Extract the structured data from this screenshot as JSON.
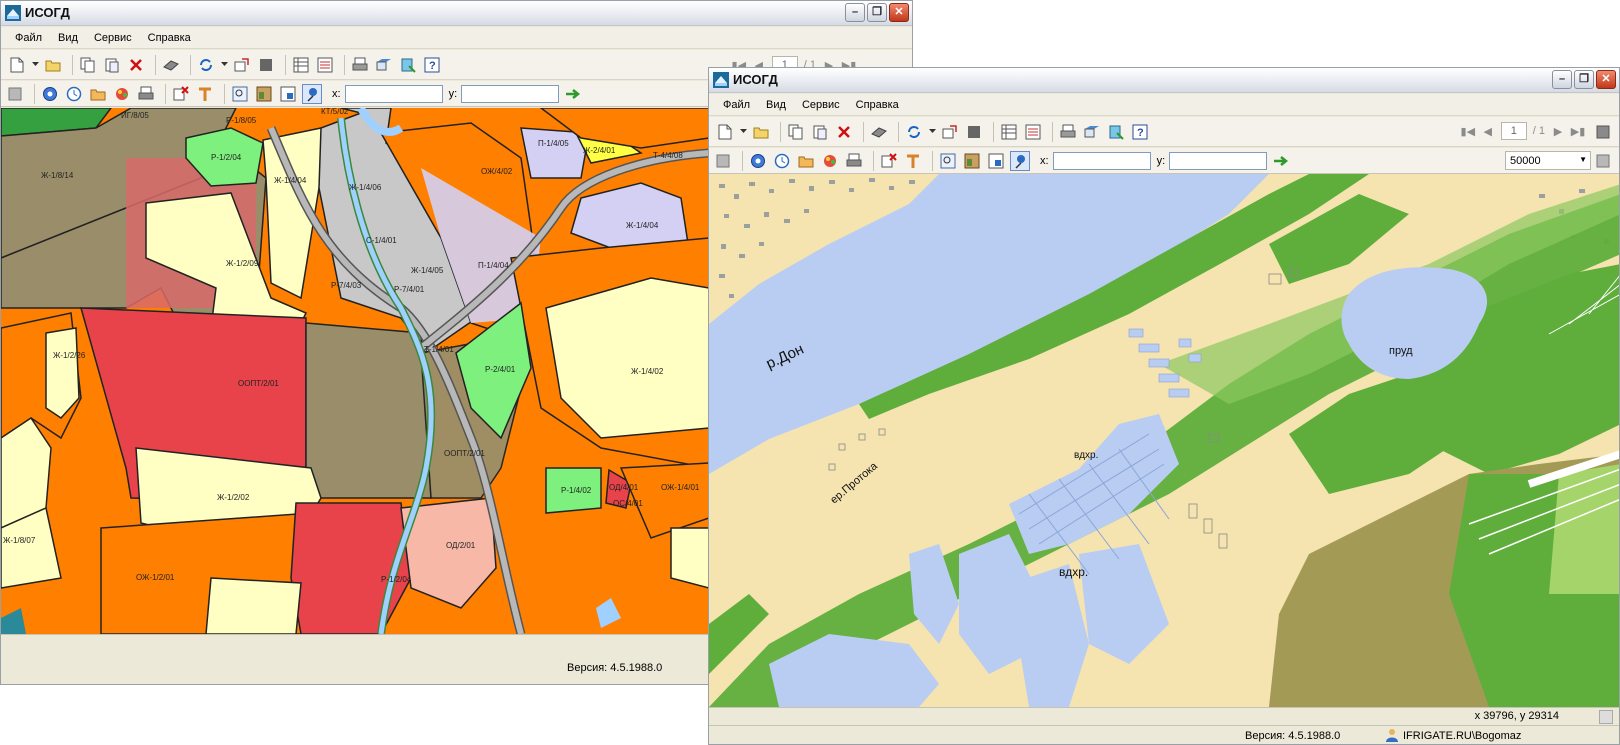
{
  "left_window": {
    "title": "ИСОГД",
    "menu": [
      "Файл",
      "Вид",
      "Сервис",
      "Справка"
    ],
    "coords": {
      "x_label": "x:",
      "x_value": "",
      "y_label": "y:",
      "y_value": ""
    },
    "version": "Версия: 4.5.1988.0",
    "map_labels": {
      "z1": "ИГ/8/05",
      "z2": "Р-1/8/05",
      "z3": "КТ/5/02",
      "z4": "Р-1/2/04",
      "z5": "Ж-1/8/14",
      "z6": "Ж-1/4/04",
      "z7": "Ж-1/4/06",
      "z8": "П-1/4/05",
      "z9": "Ж-2/4/01",
      "z10": "Т-4/4/08",
      "z11": "ОЖ/4/02",
      "z12": "С-1/4/01",
      "z13": "Ж-1/4/05",
      "z14": "Ж-1/4/04",
      "z15": "Ж-1/2/09",
      "z16": "П-1/4/04",
      "z17": "Р-7/4/03",
      "z18": "Р-7/4/01",
      "z19": "Т-1/4/01",
      "z20": "Р-2/4/01",
      "z21": "Ж-1/4/02",
      "z22": "Ж-1/2/26",
      "z23": "ООПТ/2/01",
      "z24": "ООПТ/2/01",
      "z25": "Ж-1/2/02",
      "z26": "Р-1/4/02",
      "z27": "ОД/4/01",
      "z28": "ОС/4/01",
      "z29": "ОЖ-1/4/01",
      "z30": "Ж-1/8/07",
      "z31": "ОЖ-1/2/01",
      "z32": "ОД/2/01",
      "z33": "Р-1/2/04"
    }
  },
  "right_window": {
    "title": "ИСОГД",
    "menu": [
      "Файл",
      "Вид",
      "Сервис",
      "Справка"
    ],
    "coords": {
      "x_label": "x:",
      "x_value": "",
      "y_label": "y:",
      "y_value": ""
    },
    "scale": "50000",
    "pager": {
      "current": "1",
      "total": "/ 1"
    },
    "map_labels": {
      "river": "р.Дон",
      "pond": "пруд",
      "reservoir1": "вдхр.",
      "reservoir2": "вдхр.",
      "channel": "ер.Протока"
    },
    "cursor_position": "x 39796, y 29314",
    "version": "Версия: 4.5.1988.0",
    "user": "IFRIGATE.RU\\Bogomaz"
  },
  "background_window": {
    "pager": {
      "current": "1",
      "total": "/ 1"
    }
  },
  "colors": {
    "zone_orange": "#ff7f00",
    "zone_yellow": "#ffffc4",
    "zone_red": "#e8434b",
    "zone_olive": "#9a8e6a",
    "zone_green": "#7ef07e",
    "zone_gray": "#c8c8c8",
    "zone_lavender": "#d4d0f4",
    "map_water": "#b9cdf2",
    "map_sand": "#f5e3b0",
    "map_green": "#5fae3c",
    "map_olive": "#a39a55"
  }
}
